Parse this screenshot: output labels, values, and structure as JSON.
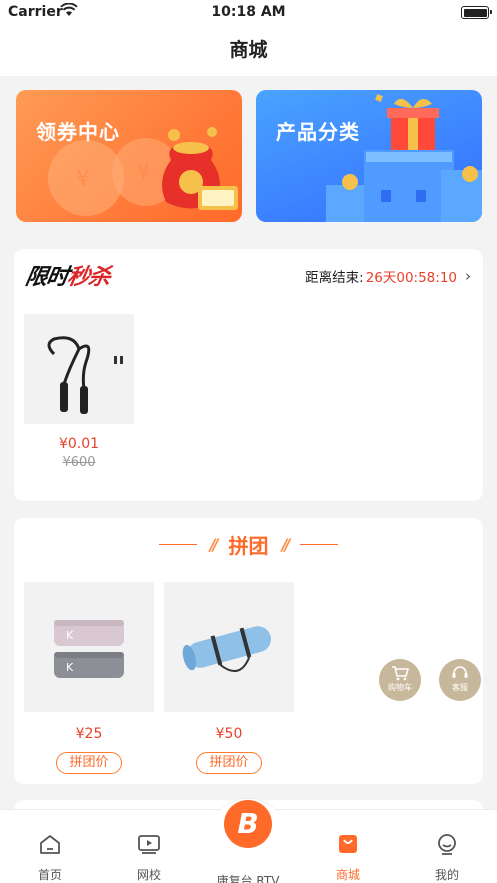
{
  "status_bar": {
    "carrier": "Carrier",
    "time": "10:18 AM"
  },
  "nav": {
    "title": "商城"
  },
  "banners": {
    "coupon_label": "领券中心",
    "category_label": "产品分类"
  },
  "flash_sale": {
    "logo_text_a": "限时",
    "logo_text_b": "秒杀",
    "countdown_label": "距离结束:",
    "countdown_value": "26天00:58:10",
    "products": [
      {
        "name": "jump-rope",
        "price": "¥0.01",
        "old_price": "¥600"
      }
    ]
  },
  "group_buy": {
    "title": "拼团",
    "products": [
      {
        "name": "resistance-bands",
        "price": "¥25",
        "tag": "拼团价"
      },
      {
        "name": "yoga-mat",
        "price": "¥50",
        "tag": "拼团价"
      }
    ]
  },
  "floating": {
    "cart_label": "购物车",
    "service_label": "客服"
  },
  "tabbar": {
    "items": [
      {
        "label": "首页"
      },
      {
        "label": "网校"
      },
      {
        "label": "康复台.RTV"
      },
      {
        "label": "商城"
      },
      {
        "label": "我的"
      }
    ],
    "active": "商城"
  },
  "colors": {
    "accent": "#ff6a2a",
    "price": "#e8412b",
    "background": "#f3f3f3"
  }
}
